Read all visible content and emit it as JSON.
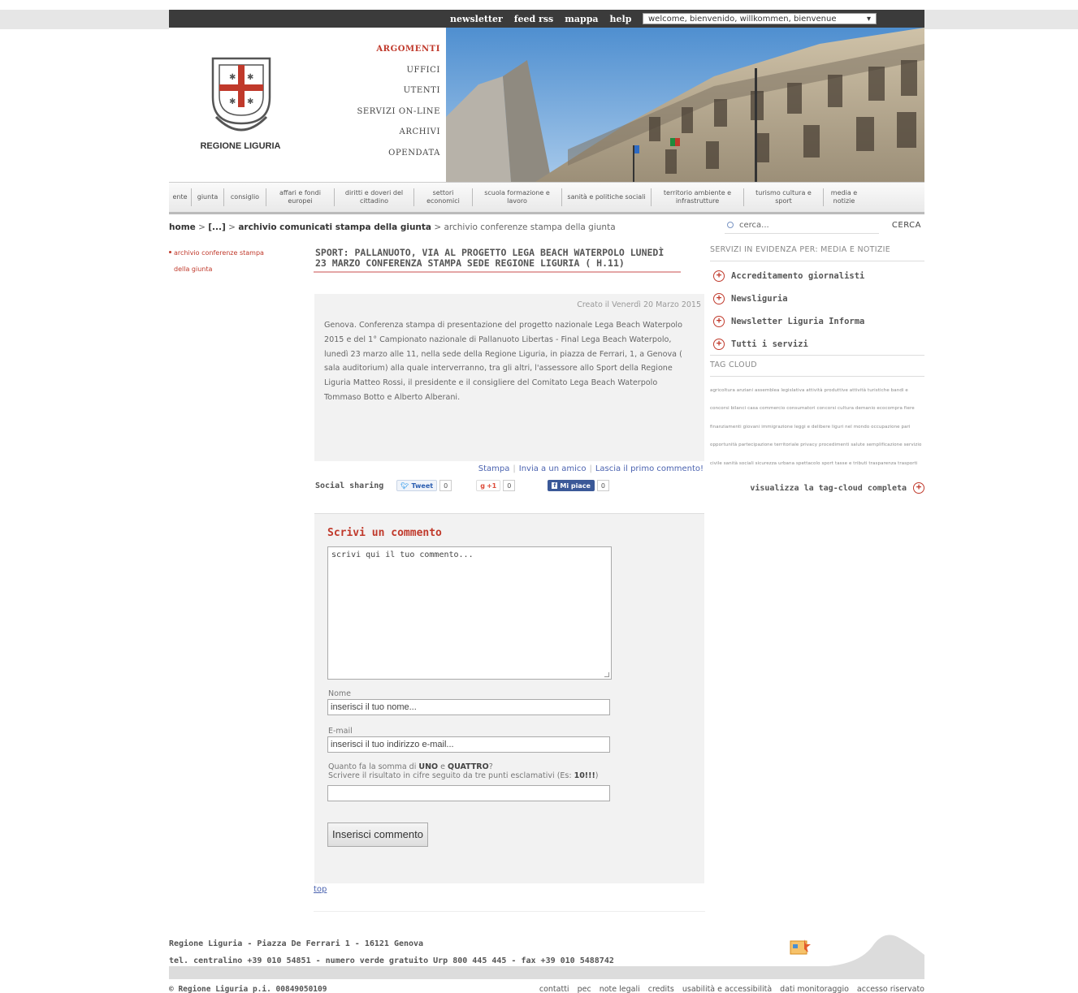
{
  "util_bar": {
    "links": [
      "newsletter",
      "feed rss",
      "mappa",
      "help"
    ],
    "language_select": "welcome, bienvenido, willkommen, bienvenue"
  },
  "logo_text": "REGIONE LIGURIA",
  "main_nav": [
    "ARGOMENTI",
    "UFFICI",
    "UTENTI",
    "SERVIZI ON-LINE",
    "ARCHIVI",
    "OPENDATA"
  ],
  "categories": [
    "ente",
    "giunta",
    "consiglio",
    "affari e fondi europei",
    "diritti e doveri del cittadino",
    "settori economici",
    "scuola formazione e lavoro",
    "sanità e politiche sociali",
    "territorio ambiente e infrastrutture",
    "turismo cultura e sport",
    "media e notizie"
  ],
  "breadcrumb": {
    "home": "home",
    "sep": " > ",
    "ellipsis": "[...]",
    "parent": "archivio comunicati stampa della giunta",
    "current": "archivio conferenze stampa della giunta"
  },
  "search": {
    "placeholder": "cerca...",
    "button": "CERCA"
  },
  "left_nav": [
    "archivio conferenze stampa",
    "della giunta"
  ],
  "article": {
    "title": "SPORT: PALLANUOTO, VIA AL PROGETTO LEGA BEACH WATERPOLO LUNEDÌ 23 MARZO CONFERENZA STAMPA SEDE REGIONE LIGURIA ( H.11)",
    "created": "Creato il Venerdì 20 Marzo 2015",
    "body": "Genova. Conferenza stampa di presentazione del progetto nazionale Lega Beach Waterpolo 2015 e del 1° Campionato nazionale di Pallanuoto Libertas - Final Lega Beach Waterpolo,  lunedì 23 marzo alle  11, nella sede della Regione Liguria, in piazza de Ferrari, 1, a Genova ( sala auditorium) alla quale interverranno, tra gli altri, l'assessore allo Sport della Regione Liguria  Matteo Rossi, il presidente e il consigliere  del Comitato Lega Beach Waterpolo Tommaso Botto e Alberto Alberani.",
    "actions": [
      "Stampa",
      "Invia a un amico",
      "Lascia il primo commento!"
    ]
  },
  "social": {
    "label": "Social sharing",
    "tweet": "Tweet",
    "tweet_count": "0",
    "gplus": "+1",
    "gplus_count": "0",
    "like": "Mi piace",
    "like_count": "0"
  },
  "comment_form": {
    "title": "Scrivi un commento",
    "textarea": "scrivi qui il tuo commento...",
    "name_label": "Nome",
    "name_value": "inserisci il tuo nome...",
    "email_label": "E-mail",
    "email_value": "inserisci il tuo indirizzo e-mail...",
    "captcha_q_prefix": "Quanto fa la somma di ",
    "captcha_q_a": "UNO",
    "captcha_q_and": " e ",
    "captcha_q_b": "QUATTRO",
    "captcha_q_suffix": "?",
    "captcha_hint_prefix": "Scrivere il risultato in cifre seguito da tre punti esclamativi (Es: ",
    "captcha_hint_example": "10!!!",
    "captcha_hint_suffix": ")",
    "submit": "Inserisci commento",
    "top": "top"
  },
  "sidebar": {
    "services_header": "SERVIZI IN EVIDENZA PER: MEDIA E NOTIZIE",
    "services": [
      "Accreditamento giornalisti",
      "Newsliguria",
      "Newsletter Liguria Informa",
      "Tutti i servizi"
    ],
    "tag_header": "TAG CLOUD",
    "tags": "agricoltura anziani assemblea legislativa attività produttive attività turistiche bandi e concorsi bilanci casa commercio consumatori concorsi cultura demanio ecocompra fiere finanziamenti giovani immigrazione leggi e delibere liguri nel mondo occupazione pari opportunità partecipazione territoriale privacy procedimenti salute semplificazione servizio civile sanità sociali sicurezza urbana spettacolo sport tasse e tributi trasparenza trasporti",
    "tagcloud_link": "visualizza la tag-cloud completa"
  },
  "footer": {
    "address": "Regione Liguria - Piazza De Ferrari 1 - 16121 Genova",
    "phones": "tel. centralino +39 010 54851 - numero verde gratuito Urp 800 445 445 - fax +39 010 5488742",
    "copyright": "© Regione Liguria p.i. 00849050109",
    "links": [
      "contatti",
      "pec",
      "note legali",
      "credits",
      "usabilità e accessibilità",
      "dati monitoraggio",
      "accesso riservato"
    ]
  },
  "colors": {
    "accent_red": "#c0392b",
    "link_blue": "#4b63b0",
    "util_bar": "#3b3b3b",
    "panel_grey": "#f2f2f2"
  }
}
